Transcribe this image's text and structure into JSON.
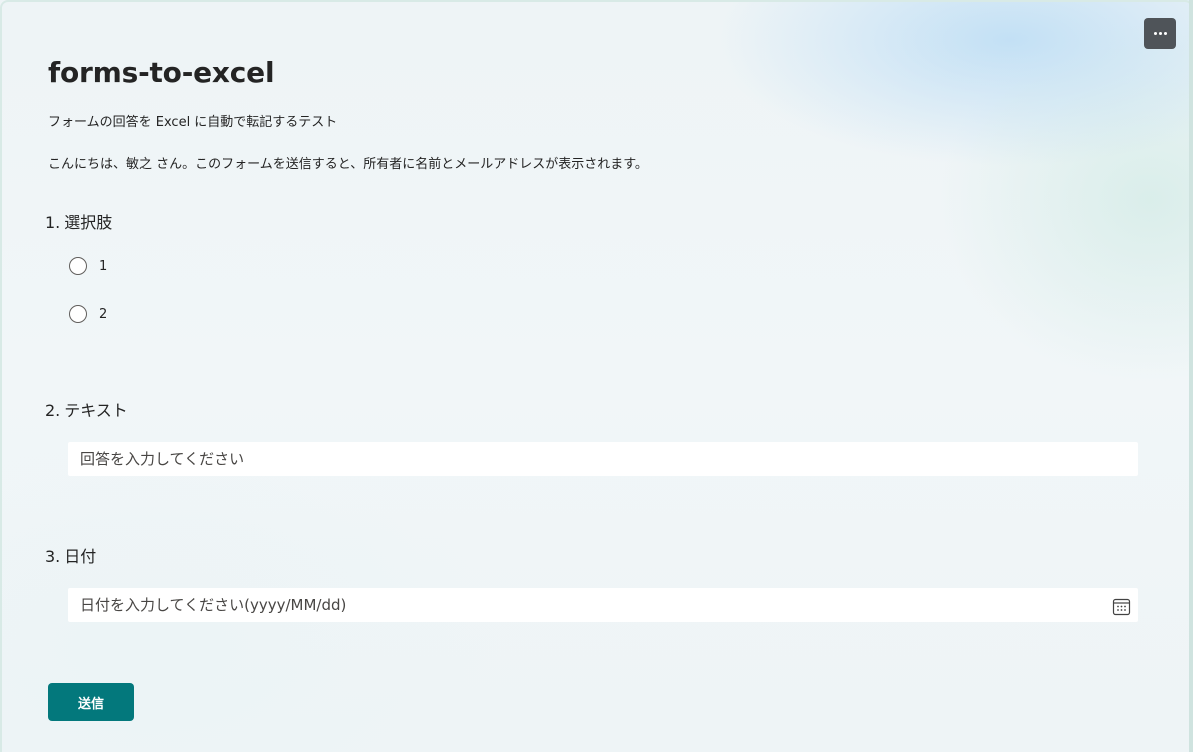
{
  "header": {
    "more_button_label": "…"
  },
  "form": {
    "title": "forms-to-excel",
    "description": "フォームの回答を Excel に自動で転記するテスト",
    "greeting": "こんにちは、敏之 さん。このフォームを送信すると、所有者に名前とメールアドレスが表示されます。"
  },
  "questions": [
    {
      "number": "1.",
      "title": "選択肢",
      "type": "choice",
      "options": [
        "1",
        "2"
      ]
    },
    {
      "number": "2.",
      "title": "テキスト",
      "type": "text",
      "placeholder": "回答を入力してください"
    },
    {
      "number": "3.",
      "title": "日付",
      "type": "date",
      "placeholder": "日付を入力してください(yyyy/MM/dd)",
      "icon": "calendar-icon"
    }
  ],
  "submit": {
    "label": "送信"
  },
  "colors": {
    "accent": "#03787c",
    "more_button_bg": "#4f5459",
    "text": "#242424"
  }
}
